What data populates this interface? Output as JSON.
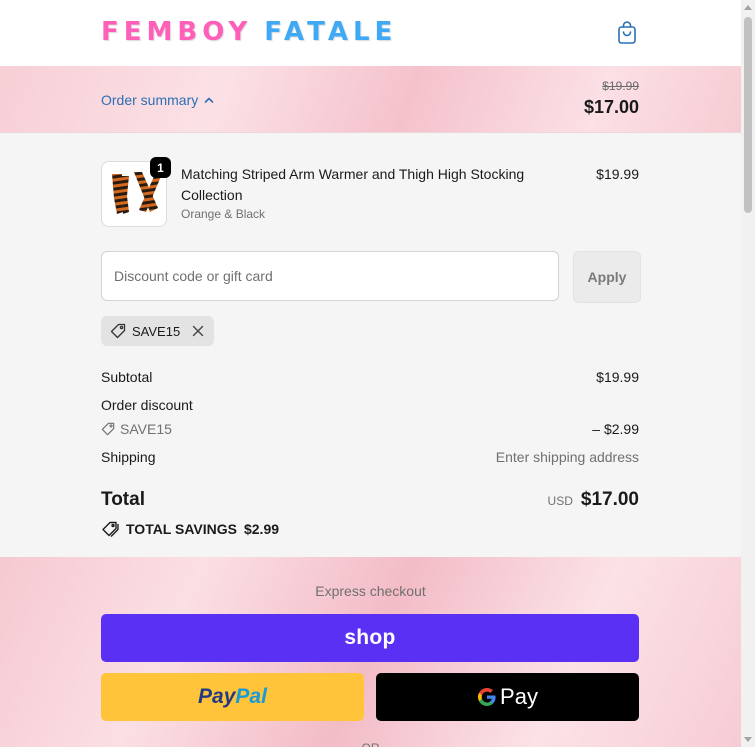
{
  "header": {
    "logo_word1": "FEMBOY",
    "logo_word2": "FATALE",
    "cart_icon": "shopping-bag-icon"
  },
  "summary": {
    "toggle_label": "Order summary",
    "original_price": "$19.99",
    "discounted_price": "$17.00"
  },
  "line_item": {
    "quantity": "1",
    "name": "Matching Striped Arm Warmer and Thigh High Stocking Collection",
    "variant": "Orange & Black",
    "price": "$19.99"
  },
  "discount": {
    "placeholder": "Discount code or gift card",
    "apply_label": "Apply",
    "applied_code": "SAVE15"
  },
  "costs": {
    "subtotal_label": "Subtotal",
    "subtotal_value": "$19.99",
    "order_discount_label": "Order discount",
    "discount_code": "SAVE15",
    "discount_value": "– $2.99",
    "shipping_label": "Shipping",
    "shipping_value": "Enter shipping address",
    "total_label": "Total",
    "currency": "USD",
    "total_value": "$17.00",
    "savings_label": "TOTAL SAVINGS",
    "savings_value": "$2.99"
  },
  "express": {
    "label": "Express checkout",
    "shop_pay_label": "shop",
    "paypal_label_1": "Pay",
    "paypal_label_2": "Pal",
    "gpay_label": "Pay",
    "or_label": "OR"
  },
  "colors": {
    "shop_pay": "#5a31f4",
    "paypal": "#ffc439",
    "link": "#2d6fb3",
    "logo_pink": "#ff5fb8",
    "logo_blue": "#3fa9f5"
  }
}
